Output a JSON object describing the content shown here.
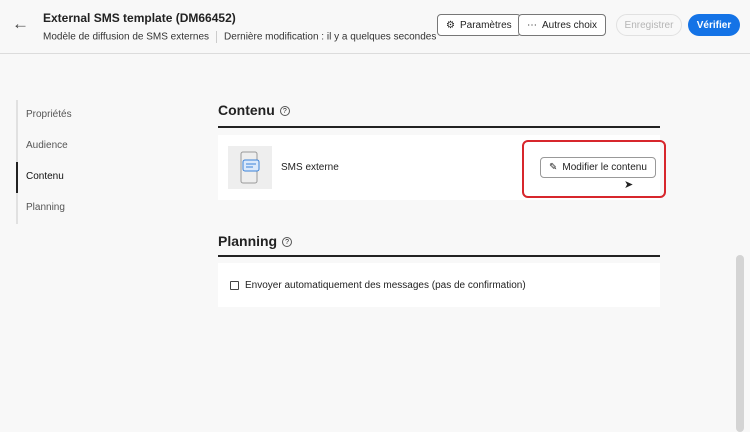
{
  "header": {
    "title": "External SMS template (DM66452)",
    "subtitle": "Modèle de diffusion de SMS externes",
    "last_modified": "Dernière modification : il y a quelques secondes",
    "settings_label": "Paramètres",
    "more_label": "Autres choix",
    "save_label": "Enregistrer",
    "verify_label": "Vérifier"
  },
  "nav": {
    "items": [
      {
        "label": "Propriétés"
      },
      {
        "label": "Audience"
      },
      {
        "label": "Contenu"
      },
      {
        "label": "Planning"
      }
    ]
  },
  "content": {
    "title": "Contenu",
    "channel": "SMS externe",
    "edit_label": "Modifier le contenu"
  },
  "planning": {
    "title": "Planning",
    "auto_send_label": "Envoyer automatiquement des messages (pas de confirmation)",
    "auto_send_checked": false
  },
  "colors": {
    "accent": "#1473e6",
    "highlight": "#d7262c"
  }
}
